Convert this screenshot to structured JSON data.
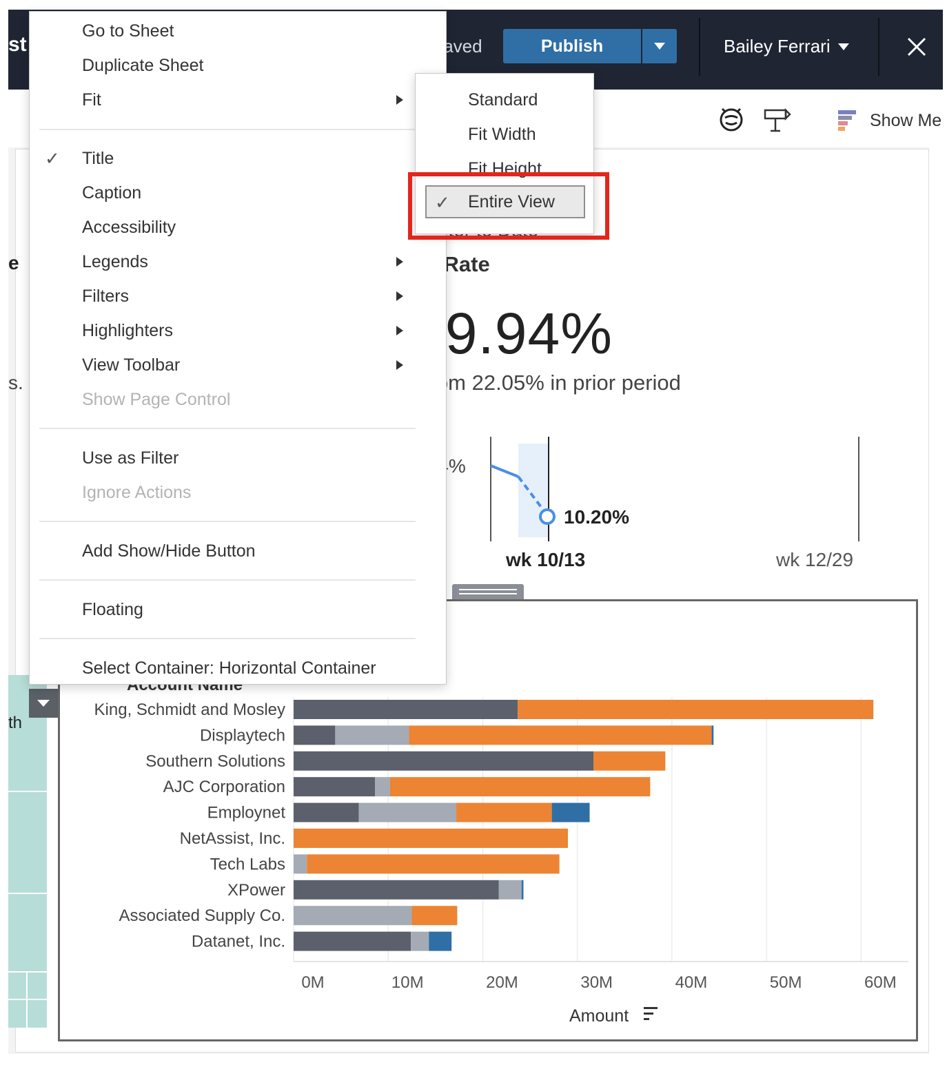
{
  "header": {
    "left_fragment": "st",
    "save_status": "s saved",
    "publish_label": "Publish",
    "user_name": "Bailey Ferrari"
  },
  "toolbar": {
    "show_me_label": "Show Me"
  },
  "dashboard": {
    "left_fragment_e": "e",
    "left_fragment_s": "s.",
    "left_fragment_th": "th",
    "kpi": {
      "subtitle_fragment": "uarter to Date",
      "heading_fragment": "n Rate",
      "value_fragment": "29.94%",
      "compare_fragment": "from 22.05% in prior period"
    },
    "sparkline": {
      "start_label_fragment": ".94%",
      "point_label": "10.20%",
      "x_label_current": "wk 10/13",
      "x_label_end": "wk 12/29"
    }
  },
  "context_menu": {
    "items": [
      {
        "label": "Go to Sheet",
        "checked": false,
        "submenu": false,
        "disabled": false
      },
      {
        "label": "Duplicate Sheet",
        "checked": false,
        "submenu": false,
        "disabled": false
      },
      {
        "label": "Fit",
        "checked": false,
        "submenu": true,
        "disabled": false
      },
      {
        "label": "Title",
        "checked": true,
        "submenu": false,
        "disabled": false
      },
      {
        "label": "Caption",
        "checked": false,
        "submenu": false,
        "disabled": false
      },
      {
        "label": "Accessibility",
        "checked": false,
        "submenu": false,
        "disabled": false
      },
      {
        "label": "Legends",
        "checked": false,
        "submenu": true,
        "disabled": false
      },
      {
        "label": "Filters",
        "checked": false,
        "submenu": true,
        "disabled": false
      },
      {
        "label": "Highlighters",
        "checked": false,
        "submenu": true,
        "disabled": false
      },
      {
        "label": "View Toolbar",
        "checked": false,
        "submenu": true,
        "disabled": false
      },
      {
        "label": "Show Page Control",
        "checked": false,
        "submenu": false,
        "disabled": true
      },
      {
        "label": "Use as Filter",
        "checked": false,
        "submenu": false,
        "disabled": false
      },
      {
        "label": "Ignore Actions",
        "checked": false,
        "submenu": false,
        "disabled": true
      },
      {
        "label": "Add Show/Hide Button",
        "checked": false,
        "submenu": false,
        "disabled": false
      },
      {
        "label": "Floating",
        "checked": false,
        "submenu": false,
        "disabled": false
      },
      {
        "label": "Select Container: Horizontal Container",
        "checked": false,
        "submenu": false,
        "disabled": false
      }
    ],
    "check_glyph": "✓"
  },
  "fit_submenu": {
    "items": [
      "Standard",
      "Fit Width",
      "Fit Height",
      "Entire View"
    ],
    "selected": "Entire View"
  },
  "colors": {
    "header_bg": "#1f2533",
    "publish_blue": "#2f6fa6",
    "highlight_red": "#e3261c",
    "bar_dark": "#5b606c",
    "bar_light": "#a4abb5",
    "bar_orange": "#ec8433",
    "bar_blue": "#2f6fa6",
    "line_blue": "#4a90e2"
  },
  "chart_data": {
    "type": "bar",
    "orientation": "horizontal",
    "stacked": true,
    "header_fragment": "Account Name",
    "xlabel": "Amount",
    "categories": [
      "King, Schmidt and Mosley",
      "Displaytech",
      "Southern Solutions",
      "AJC Corporation",
      "Employnet",
      "NetAssist, Inc.",
      "Tech Labs",
      "XPower",
      "Associated Supply Co.",
      "Datanet, Inc."
    ],
    "series": [
      {
        "color": "#5b606c",
        "values": [
          23.7,
          4.4,
          31.7,
          8.6,
          6.9,
          0,
          0,
          21.7,
          0,
          12.4
        ]
      },
      {
        "color": "#a4abb5",
        "values": [
          0,
          7.8,
          0,
          1.6,
          10.3,
          0,
          1.4,
          2.4,
          12.5,
          1.9
        ]
      },
      {
        "color": "#ec8433",
        "values": [
          37.6,
          32.0,
          7.6,
          27.5,
          10.1,
          29.0,
          26.7,
          0,
          4.8,
          0
        ]
      },
      {
        "color": "#2f6fa6",
        "values": [
          0,
          0.2,
          0,
          0,
          4.0,
          0,
          0,
          0.2,
          0,
          2.4
        ]
      }
    ],
    "xlim": [
      0,
      65
    ],
    "xticks": [
      "0M",
      "10M",
      "20M",
      "30M",
      "40M",
      "50M",
      "60M"
    ],
    "grid": true
  }
}
